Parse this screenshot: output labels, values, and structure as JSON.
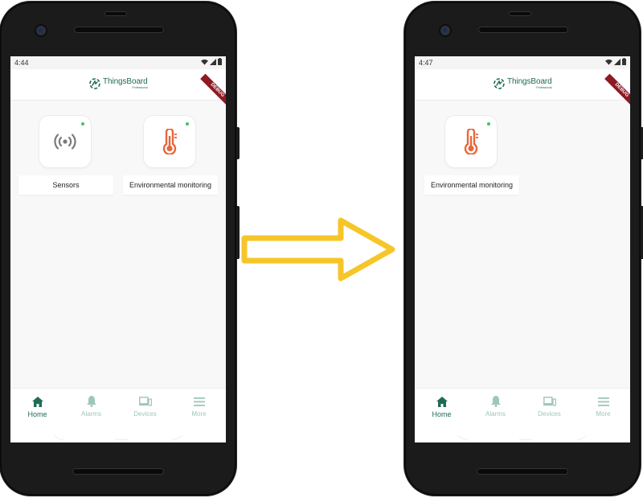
{
  "colors": {
    "brand": "#1f6b57",
    "accent_nav_inactive": "#9fc6ba",
    "online_dot": "#3ec46d",
    "thermo": "#e8673a",
    "arrow": "#f6c629"
  },
  "app": {
    "name": "ThingsBoard",
    "edition": "Professional",
    "debug_label": "DEBUG"
  },
  "before": {
    "time": "4:44",
    "tiles": [
      {
        "label": "Sensors",
        "icon": "wifi-sensor-icon"
      },
      {
        "label": "Environmental monitoring",
        "icon": "thermometer-icon"
      }
    ]
  },
  "after": {
    "time": "4:47",
    "tiles": [
      {
        "label": "Environmental monitoring",
        "icon": "thermometer-icon"
      }
    ]
  },
  "nav": [
    {
      "label": "Home",
      "icon": "home-icon",
      "active": true
    },
    {
      "label": "Alarms",
      "icon": "bell-icon",
      "active": false
    },
    {
      "label": "Devices",
      "icon": "devices-icon",
      "active": false
    },
    {
      "label": "More",
      "icon": "menu-icon",
      "active": false
    }
  ]
}
